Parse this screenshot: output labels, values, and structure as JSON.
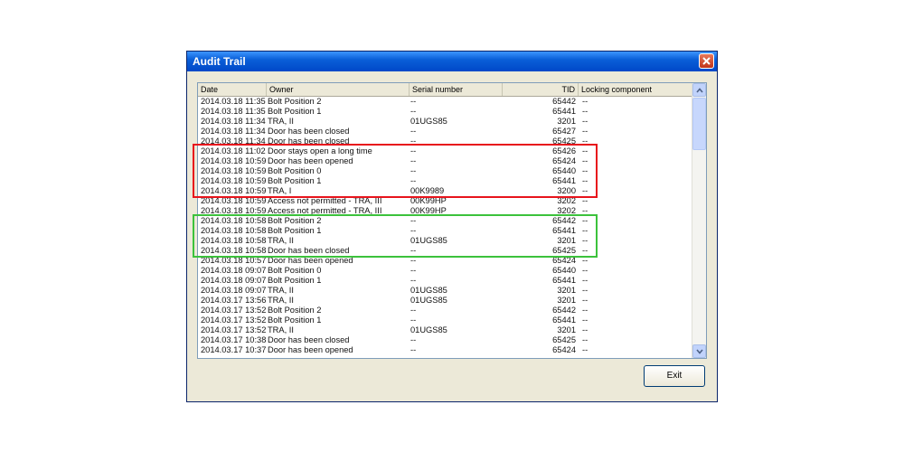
{
  "window": {
    "title": "Audit Trail"
  },
  "columns": [
    "Date",
    "Owner",
    "Serial number",
    "TID",
    "Locking component"
  ],
  "rows": [
    {
      "date": "2014.03.18 11:35",
      "owner": "Bolt Position 2",
      "serial": "--",
      "tid": "65442",
      "lock": "--"
    },
    {
      "date": "2014.03.18 11:35",
      "owner": "Bolt Position 1",
      "serial": "--",
      "tid": "65441",
      "lock": "--"
    },
    {
      "date": "2014.03.18 11:34",
      "owner": "TRA, II",
      "serial": "01UGS85",
      "tid": "3201",
      "lock": "--"
    },
    {
      "date": "2014.03.18 11:34",
      "owner": "Door has been closed",
      "serial": "--",
      "tid": "65427",
      "lock": "--"
    },
    {
      "date": "2014.03.18 11:34",
      "owner": "Door has been closed",
      "serial": "--",
      "tid": "65425",
      "lock": "--"
    },
    {
      "date": "2014.03.18 11:02",
      "owner": "Door stays open a long time",
      "serial": "--",
      "tid": "65426",
      "lock": "--"
    },
    {
      "date": "2014.03.18 10:59",
      "owner": "Door has been opened",
      "serial": "--",
      "tid": "65424",
      "lock": "--"
    },
    {
      "date": "2014.03.18 10:59",
      "owner": "Bolt Position 0",
      "serial": "--",
      "tid": "65440",
      "lock": "--"
    },
    {
      "date": "2014.03.18 10:59",
      "owner": "Bolt Position 1",
      "serial": "--",
      "tid": "65441",
      "lock": "--"
    },
    {
      "date": "2014.03.18 10:59",
      "owner": "TRA, I",
      "serial": "00K9989",
      "tid": "3200",
      "lock": "--"
    },
    {
      "date": "2014.03.18 10:59",
      "owner": "Access not permitted - TRA, III",
      "serial": "00K99HP",
      "tid": "3202",
      "lock": "--"
    },
    {
      "date": "2014.03.18 10:59",
      "owner": "Access not permitted - TRA, III",
      "serial": "00K99HP",
      "tid": "3202",
      "lock": "--"
    },
    {
      "date": "2014.03.18 10:58",
      "owner": "Bolt Position 2",
      "serial": "--",
      "tid": "65442",
      "lock": "--"
    },
    {
      "date": "2014.03.18 10:58",
      "owner": "Bolt Position 1",
      "serial": "--",
      "tid": "65441",
      "lock": "--"
    },
    {
      "date": "2014.03.18 10:58",
      "owner": "TRA, II",
      "serial": "01UGS85",
      "tid": "3201",
      "lock": "--"
    },
    {
      "date": "2014.03.18 10:58",
      "owner": "Door has been closed",
      "serial": "--",
      "tid": "65425",
      "lock": "--"
    },
    {
      "date": "2014.03.18 10:57",
      "owner": "Door has been opened",
      "serial": "--",
      "tid": "65424",
      "lock": "--"
    },
    {
      "date": "2014.03.18 09:07",
      "owner": "Bolt Position 0",
      "serial": "--",
      "tid": "65440",
      "lock": "--"
    },
    {
      "date": "2014.03.18 09:07",
      "owner": "Bolt Position 1",
      "serial": "--",
      "tid": "65441",
      "lock": "--"
    },
    {
      "date": "2014.03.18 09:07",
      "owner": "TRA, II",
      "serial": "01UGS85",
      "tid": "3201",
      "lock": "--"
    },
    {
      "date": "2014.03.17 13:56",
      "owner": "TRA, II",
      "serial": "01UGS85",
      "tid": "3201",
      "lock": "--"
    },
    {
      "date": "2014.03.17 13:52",
      "owner": "Bolt Position 2",
      "serial": "--",
      "tid": "65442",
      "lock": "--"
    },
    {
      "date": "2014.03.17 13:52",
      "owner": "Bolt Position 1",
      "serial": "--",
      "tid": "65441",
      "lock": "--"
    },
    {
      "date": "2014.03.17 13:52",
      "owner": "TRA, II",
      "serial": "01UGS85",
      "tid": "3201",
      "lock": "--"
    },
    {
      "date": "2014.03.17 10:38",
      "owner": "Door has been closed",
      "serial": "--",
      "tid": "65425",
      "lock": "--"
    },
    {
      "date": "2014.03.17 10:37",
      "owner": "Door has been opened",
      "serial": "--",
      "tid": "65424",
      "lock": "--"
    }
  ],
  "buttons": {
    "exit": "Exit"
  },
  "colors": {
    "highlight_red": "#e8141c",
    "highlight_green": "#3cc23c",
    "titlebar": "#0a5fd8"
  },
  "icons": {
    "close": "close-icon",
    "scroll_up": "chevron-up-icon",
    "scroll_down": "chevron-down-icon"
  }
}
